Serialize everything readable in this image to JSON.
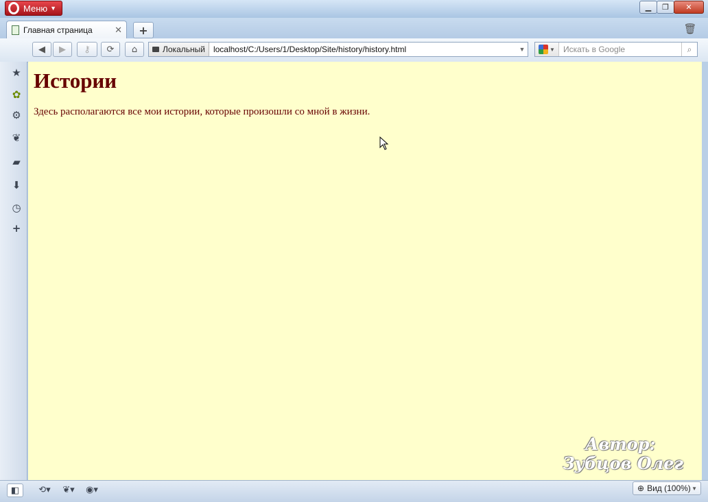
{
  "window": {
    "menu_label": "Меню",
    "ghost_title": "Opera"
  },
  "tabs": [
    {
      "label": "Главная страница"
    }
  ],
  "toolbar": {
    "address_badge": "Локальный",
    "address_url": "localhost/C:/Users/1/Desktop/Site/history/history.html",
    "search_placeholder": "Искать в Google"
  },
  "page": {
    "heading": "Истории",
    "paragraph": "Здесь располагаются все мои истории, которые произошли со мной в жизни."
  },
  "watermark": {
    "line1": "Автор:",
    "line2": "Зубцов Олег"
  },
  "statusbar": {
    "zoom_label": "Вид (100%)"
  },
  "icons": {
    "sidebar": [
      "bookmarks-icon",
      "widgets-icon",
      "settings-icon",
      "unite-icon",
      "notes-icon",
      "downloads-icon",
      "history-icon",
      "add-panel-icon"
    ]
  }
}
